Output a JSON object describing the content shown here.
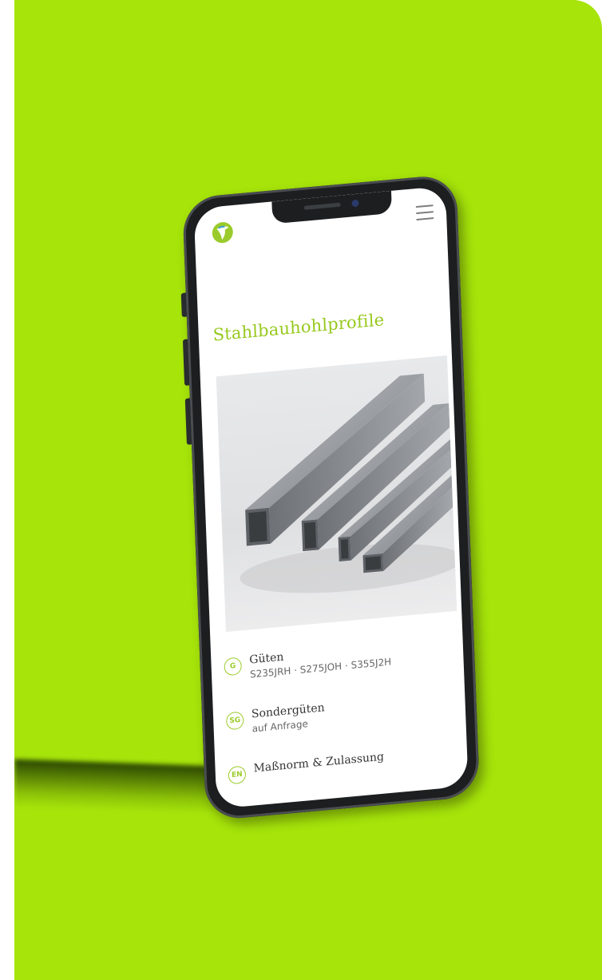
{
  "page": {
    "title": "Stahlbauhohlprofile"
  },
  "header": {
    "logo_icon": "brand-logo-icon",
    "menu_icon": "hamburger-menu-icon"
  },
  "specs": [
    {
      "icon_label": "G",
      "title": "Güten",
      "value": "S235JRH · S275JOH · S355J2H"
    },
    {
      "icon_label": "SG",
      "title": "Sondergüten",
      "value": "auf Anfrage"
    },
    {
      "icon_label": "EN",
      "title": "Maßnorm & Zulassung",
      "value": ""
    }
  ],
  "colors": {
    "background": "#a6e40a",
    "accent": "#97c91e",
    "phone_body": "#1c1e20"
  }
}
